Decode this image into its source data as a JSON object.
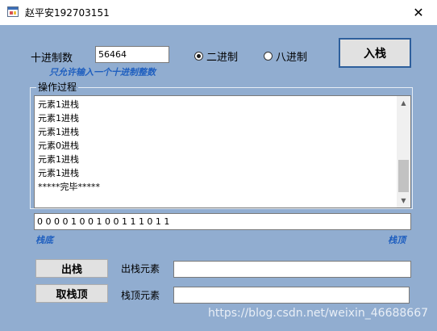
{
  "window": {
    "title": "赵平安192703151",
    "close_glyph": "✕"
  },
  "input_row": {
    "label": "十进制数",
    "value": "56464",
    "hint": "只允许输入一个十进制整数"
  },
  "radios": [
    {
      "label": "二进制",
      "selected": true
    },
    {
      "label": "八进制",
      "selected": false
    }
  ],
  "buttons": {
    "push": "入栈",
    "pop": "出栈",
    "peek": "取栈顶"
  },
  "group": {
    "title": "操作过程",
    "lines": [
      "元素1进栈",
      "元素1进栈",
      "元素1进栈",
      "元素0进栈",
      "元素1进栈",
      "元素1进栈",
      "*****完毕*****"
    ]
  },
  "stack": {
    "content": "0 0 0 0 1 0 0 1 0 0 1 1 1 0 1 1",
    "bottom_label": "栈底",
    "top_label": "栈顶"
  },
  "fields": {
    "pop_label": "出栈元素",
    "pop_value": "",
    "top_label": "栈顶元素",
    "top_value": ""
  },
  "watermark": "https://blog.csdn.net/weixin_46688667"
}
